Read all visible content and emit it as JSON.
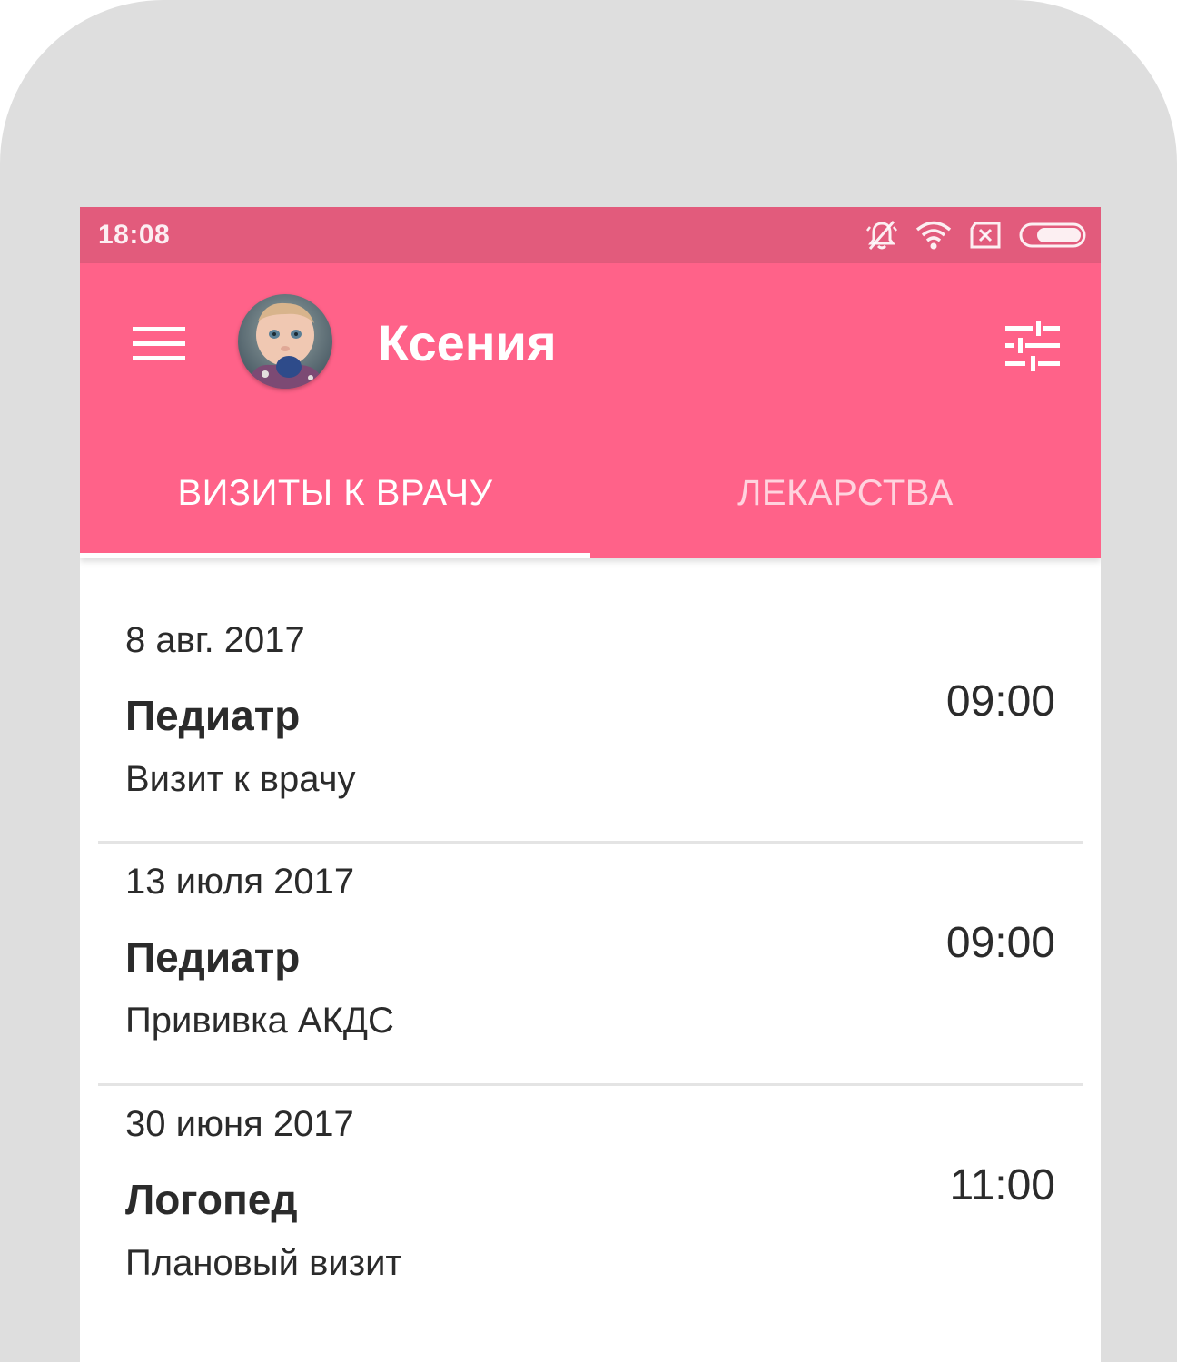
{
  "status_bar": {
    "time": "18:08",
    "icons": [
      "bell-off-icon",
      "wifi-icon",
      "sim-x-icon",
      "battery-icon"
    ]
  },
  "app_bar": {
    "menu_icon": "hamburger-icon",
    "title": "Ксения",
    "filter_icon": "sliders-icon",
    "color": "#ff6289",
    "status_color": "#e25b7c"
  },
  "tabs": [
    {
      "label": "ВИЗИТЫ К ВРАЧУ",
      "active": true
    },
    {
      "label": "ЛЕКАРСТВА",
      "active": false
    }
  ],
  "visits": [
    {
      "date": "8 авг. 2017",
      "doctor": "Педиатр",
      "description": "Визит к врачу",
      "time": "09:00"
    },
    {
      "date": "13 июля 2017",
      "doctor": "Педиатр",
      "description": "Прививка АКДС",
      "time": "09:00"
    },
    {
      "date": "30 июня 2017",
      "doctor": "Логопед",
      "description": "Плановый визит",
      "time": "11:00"
    }
  ]
}
